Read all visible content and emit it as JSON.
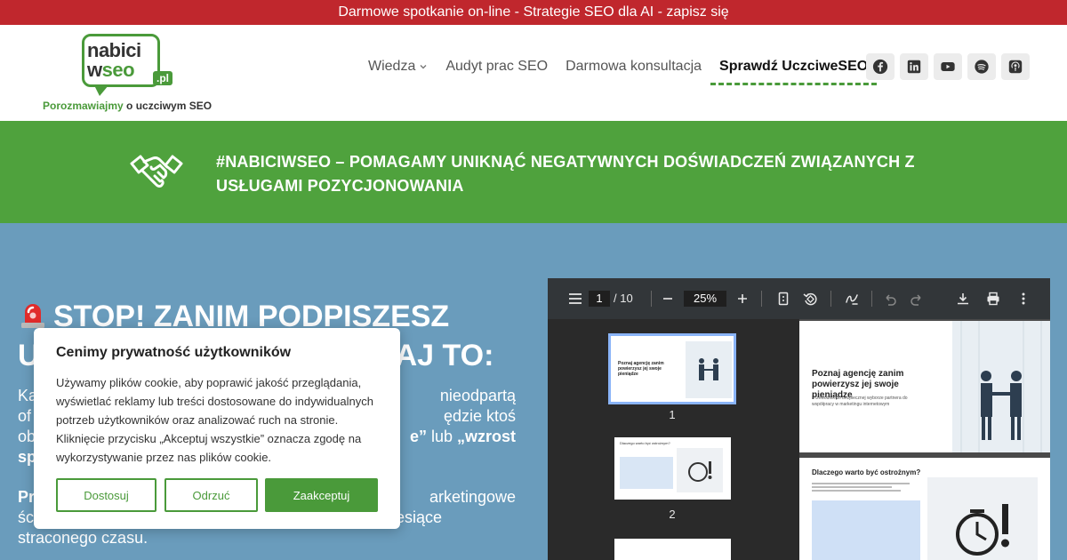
{
  "topbar": {
    "text": "Darmowe spotkanie on-line - Strategie SEO dla AI - zapisz się"
  },
  "logo": {
    "line1": "nabici",
    "line2_a": "w",
    "line2_b": "seo",
    "tld": ".pl",
    "tagline_a": "Porozmawiajmy",
    "tagline_b": " o uczciwym SEO"
  },
  "nav": {
    "items": [
      {
        "label": "Wiedza"
      },
      {
        "label": "Audyt prac SEO"
      },
      {
        "label": "Darmowa konsultacja"
      },
      {
        "label": "Sprawdź UczciweSEO"
      }
    ]
  },
  "social": [
    "facebook-icon",
    "linkedin-icon",
    "youtube-icon",
    "spotify-icon",
    "podcast-icon"
  ],
  "banner": {
    "text": "#NABICIWSEO – POMAGAMY UNIKNĄĆ NEGATYWNYCH DOŚWIADCZEŃ ZWIĄZANYCH Z USŁUGAMI POZYCJONOWANIA"
  },
  "hero": {
    "title_line1": "STOP! ZANIM PODPISZESZ",
    "title_line2_a": "U",
    "title_line2_b": "AJ TO:",
    "para1": [
      {
        "left": "Ka",
        "right": "nieodpartą"
      },
      {
        "left": "of",
        "right": "ędzie ktoś"
      },
      {
        "left": "ob",
        "right_bold": "e”",
        "right": " lub ",
        "right_bold2": "„wzrost"
      },
      {
        "left_bold": "sp"
      }
    ],
    "para2": [
      {
        "left_bold": "Pr",
        "right": "arketingowe"
      },
      {
        "left": "śc",
        "right": "esiące"
      },
      {
        "left": "straconego czasu."
      }
    ]
  },
  "pdf": {
    "page_current": "1",
    "page_total": "/ 10",
    "zoom": "25%",
    "thumbs": [
      "1",
      "2"
    ],
    "page1_title": "Poznaj agencję zanim powierzysz jej swoje pieniądze",
    "page1_sub": "Przewodnik po bezpiecznej wyborze partnera do współpracy w marketingu internetowym",
    "page2_title": "Dlaczego warto być ostrożnym?",
    "thumb1_title": "Poznaj agencję zanim powierzysz jej swoje pieniądze",
    "thumb2_title": "Dlaczego warto być ostrożnym?"
  },
  "cookie": {
    "title": "Cenimy prywatność użytkowników",
    "text": "Używamy plików cookie, aby poprawić jakość przeglądania, wyświetlać reklamy lub treści dostosowane do indywidualnych potrzeb użytkowników oraz analizować ruch na stronie. Kliknięcie przycisku „Akceptuj wszystkie” oznacza zgodę na wykorzystywanie przez nas plików cookie.",
    "btn_customize": "Dostosuj",
    "btn_reject": "Odrzuć",
    "btn_accept": "Zaakceptuj"
  },
  "colors": {
    "red": "#c0272d",
    "green": "#4fa23d",
    "brand_green": "#4a9a3a",
    "hero_bg": "#6a9cbc"
  }
}
